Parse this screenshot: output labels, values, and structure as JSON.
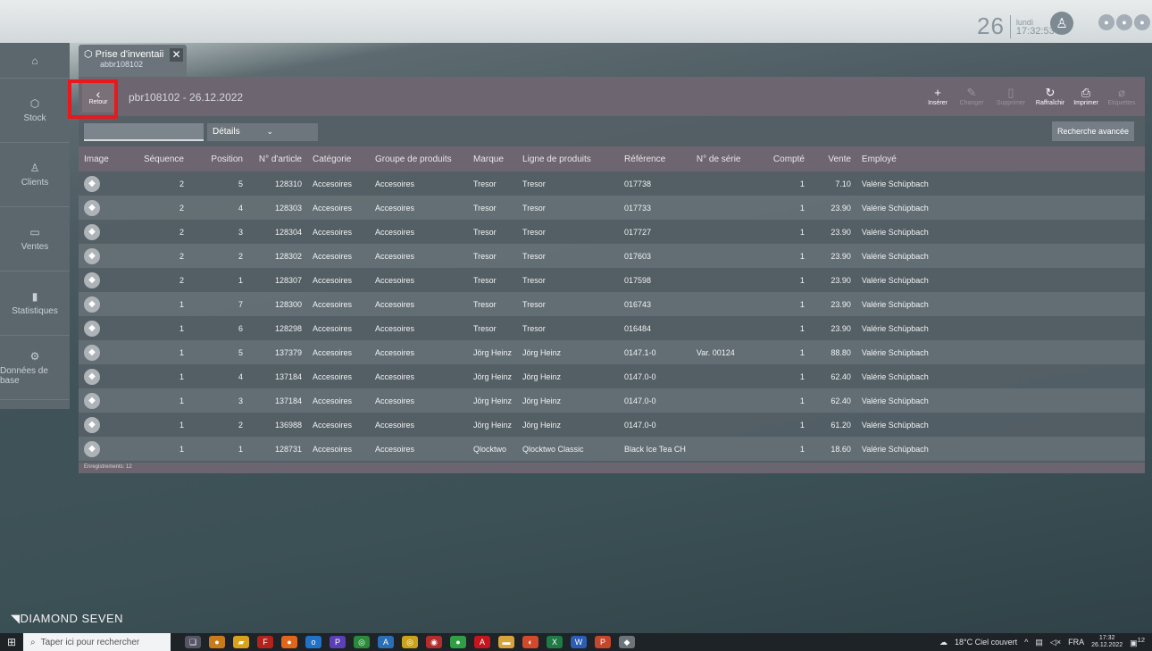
{
  "header": {
    "day": "26",
    "weekday": "lundi",
    "time": "17:32:53",
    "avatar_icon": "user-icon"
  },
  "sidebar": {
    "items": [
      {
        "label": "",
        "icon": "⌂"
      },
      {
        "label": "Stock",
        "icon": "⬡"
      },
      {
        "label": "Clients",
        "icon": "♙"
      },
      {
        "label": "Ventes",
        "icon": "▭"
      },
      {
        "label": "Statistiques",
        "icon": "▮"
      },
      {
        "label": "Données de base",
        "icon": "⚙"
      }
    ]
  },
  "tab": {
    "title": "Prise d'inventaii",
    "subtitle": "abbr108102",
    "close": "✕"
  },
  "toolbar": {
    "back_label": "Retour",
    "doc_title": "pbr108102 - 26.12.2022",
    "insert_label": "Insérer",
    "change_label": "Changer",
    "delete_label": "Supprimer",
    "refresh_label": "Raffraîchir",
    "print_label": "Imprimer",
    "label_label": "Etiquettes"
  },
  "filter": {
    "search_value": "",
    "select_value": "Détails",
    "advanced_label": "Recherche avancée"
  },
  "table": {
    "columns": [
      "Image",
      "Séquence",
      "Position",
      "N° d'article",
      "Catégorie",
      "Groupe de produits",
      "Marque",
      "Ligne de produits",
      "Référence",
      "N° de série",
      "Compté",
      "Vente",
      "Employé"
    ],
    "rows": [
      {
        "seq": "2",
        "pos": "5",
        "article": "128310",
        "cat": "Accesoires",
        "group": "Accesoires",
        "brand": "Tresor",
        "line": "Tresor",
        "ref": "017738",
        "serial": "",
        "count": "1",
        "sale": "7.10",
        "emp": "Valérie Schüpbach"
      },
      {
        "seq": "2",
        "pos": "4",
        "article": "128303",
        "cat": "Accesoires",
        "group": "Accesoires",
        "brand": "Tresor",
        "line": "Tresor",
        "ref": "017733",
        "serial": "",
        "count": "1",
        "sale": "23.90",
        "emp": "Valérie Schüpbach"
      },
      {
        "seq": "2",
        "pos": "3",
        "article": "128304",
        "cat": "Accesoires",
        "group": "Accesoires",
        "brand": "Tresor",
        "line": "Tresor",
        "ref": "017727",
        "serial": "",
        "count": "1",
        "sale": "23.90",
        "emp": "Valérie Schüpbach"
      },
      {
        "seq": "2",
        "pos": "2",
        "article": "128302",
        "cat": "Accesoires",
        "group": "Accesoires",
        "brand": "Tresor",
        "line": "Tresor",
        "ref": "017603",
        "serial": "",
        "count": "1",
        "sale": "23.90",
        "emp": "Valérie Schüpbach"
      },
      {
        "seq": "2",
        "pos": "1",
        "article": "128307",
        "cat": "Accesoires",
        "group": "Accesoires",
        "brand": "Tresor",
        "line": "Tresor",
        "ref": "017598",
        "serial": "",
        "count": "1",
        "sale": "23.90",
        "emp": "Valérie Schüpbach"
      },
      {
        "seq": "1",
        "pos": "7",
        "article": "128300",
        "cat": "Accesoires",
        "group": "Accesoires",
        "brand": "Tresor",
        "line": "Tresor",
        "ref": "016743",
        "serial": "",
        "count": "1",
        "sale": "23.90",
        "emp": "Valérie Schüpbach"
      },
      {
        "seq": "1",
        "pos": "6",
        "article": "128298",
        "cat": "Accesoires",
        "group": "Accesoires",
        "brand": "Tresor",
        "line": "Tresor",
        "ref": "016484",
        "serial": "",
        "count": "1",
        "sale": "23.90",
        "emp": "Valérie Schüpbach"
      },
      {
        "seq": "1",
        "pos": "5",
        "article": "137379",
        "cat": "Accesoires",
        "group": "Accesoires",
        "brand": "Jörg Heinz",
        "line": "Jörg Heinz",
        "ref": "0147.1-0",
        "serial": "Var. 00124",
        "count": "1",
        "sale": "88.80",
        "emp": "Valérie Schüpbach"
      },
      {
        "seq": "1",
        "pos": "4",
        "article": "137184",
        "cat": "Accesoires",
        "group": "Accesoires",
        "brand": "Jörg Heinz",
        "line": "Jörg Heinz",
        "ref": "0147.0-0",
        "serial": "",
        "count": "1",
        "sale": "62.40",
        "emp": "Valérie Schüpbach"
      },
      {
        "seq": "1",
        "pos": "3",
        "article": "137184",
        "cat": "Accesoires",
        "group": "Accesoires",
        "brand": "Jörg Heinz",
        "line": "Jörg Heinz",
        "ref": "0147.0-0",
        "serial": "",
        "count": "1",
        "sale": "62.40",
        "emp": "Valérie Schüpbach"
      },
      {
        "seq": "1",
        "pos": "2",
        "article": "136988",
        "cat": "Accesoires",
        "group": "Accesoires",
        "brand": "Jörg Heinz",
        "line": "Jörg Heinz",
        "ref": "0147.0-0",
        "serial": "",
        "count": "1",
        "sale": "61.20",
        "emp": "Valérie Schüpbach"
      },
      {
        "seq": "1",
        "pos": "1",
        "article": "128731",
        "cat": "Accesoires",
        "group": "Accesoires",
        "brand": "Qlocktwo",
        "line": "Qlocktwo Classic",
        "ref": "Black Ice Tea CH",
        "serial": "",
        "count": "1",
        "sale": "18.60",
        "emp": "Valérie Schüpbach"
      }
    ],
    "record_count": "Enregistrements: 12"
  },
  "brand": "DIAMOND SEVEN",
  "taskbar": {
    "search_placeholder": "Taper ici pour rechercher",
    "weather": "18°C Ciel couvert",
    "lang": "FRA",
    "time": "17:32",
    "date": "26.12.2022",
    "notif_count": "12"
  },
  "colors": {
    "accent_red": "#e8181c",
    "toolbar": "#6d6570"
  }
}
